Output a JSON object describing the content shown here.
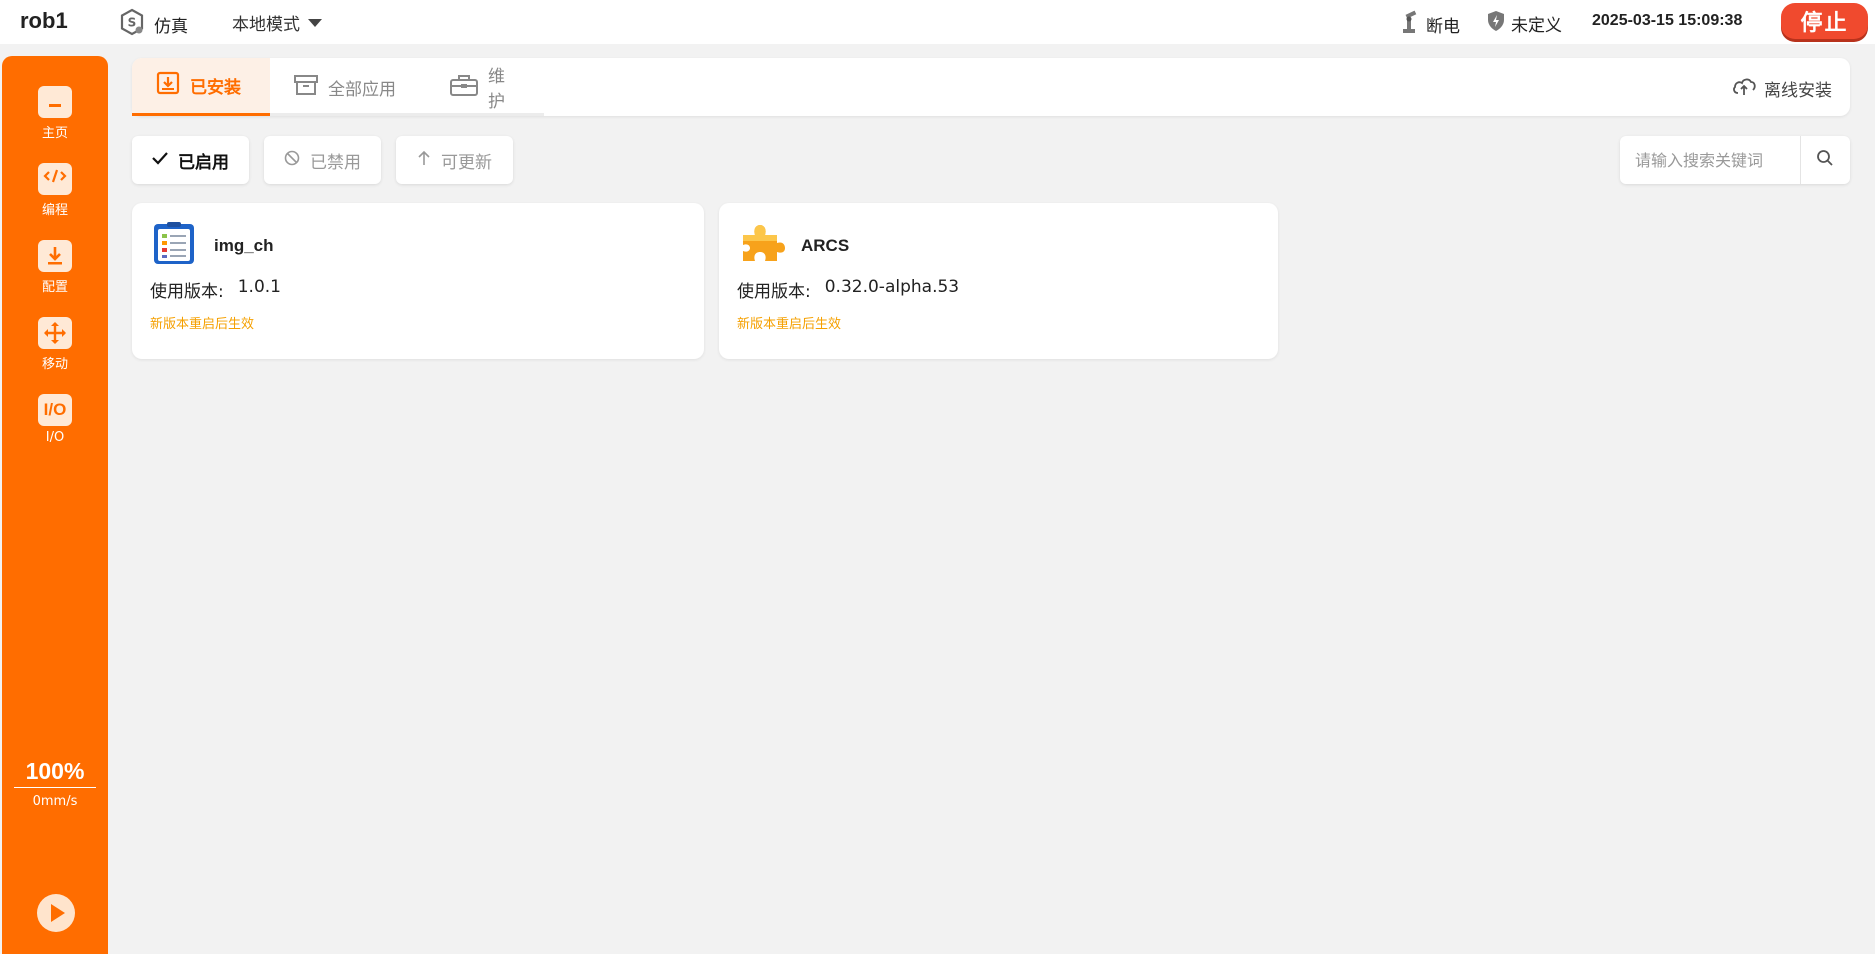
{
  "header": {
    "robot_name": "rob1",
    "sim_label": "仿真",
    "mode_label": "本地模式",
    "power_label": "断电",
    "safety_label": "未定义",
    "datetime": "2025-03-15 15:09:38",
    "stop_label": "停止"
  },
  "sidebar": {
    "items": [
      {
        "label": "主页",
        "icon": "home-icon"
      },
      {
        "label": "编程",
        "icon": "code-icon"
      },
      {
        "label": "配置",
        "icon": "config-icon"
      },
      {
        "label": "移动",
        "icon": "move-icon"
      },
      {
        "label": "I/O",
        "icon": "io-icon",
        "glyph": "I/O"
      }
    ],
    "speed_percent": "100%",
    "speed_value": "0mm/s",
    "bottom_text": "????"
  },
  "tabs": [
    {
      "label": "已安装",
      "icon": "installed-icon",
      "active": true
    },
    {
      "label": "全部应用",
      "icon": "store-icon",
      "active": false
    },
    {
      "label": "维护",
      "icon": "toolbox-icon",
      "active": false
    }
  ],
  "offline_install_label": "离线安装",
  "filters": [
    {
      "label": "已启用",
      "icon": "check-icon",
      "active": true
    },
    {
      "label": "已禁用",
      "icon": "ban-icon",
      "active": false
    },
    {
      "label": "可更新",
      "icon": "arrow-up-icon",
      "active": false
    }
  ],
  "search": {
    "placeholder": "请输入搜索关键词",
    "value": ""
  },
  "apps": [
    {
      "name": "img_ch",
      "version_label": "使用版本:",
      "version": "1.0.1",
      "note": "新版本重启后生效",
      "icon": "clipboard-icon"
    },
    {
      "name": "ARCS",
      "version_label": "使用版本:",
      "version": "0.32.0-alpha.53",
      "note": "新版本重启后生效",
      "icon": "puzzle-icon"
    }
  ],
  "colors": {
    "accent": "#ff6d00",
    "stop": "#f04a2e",
    "note": "#f5a000"
  }
}
